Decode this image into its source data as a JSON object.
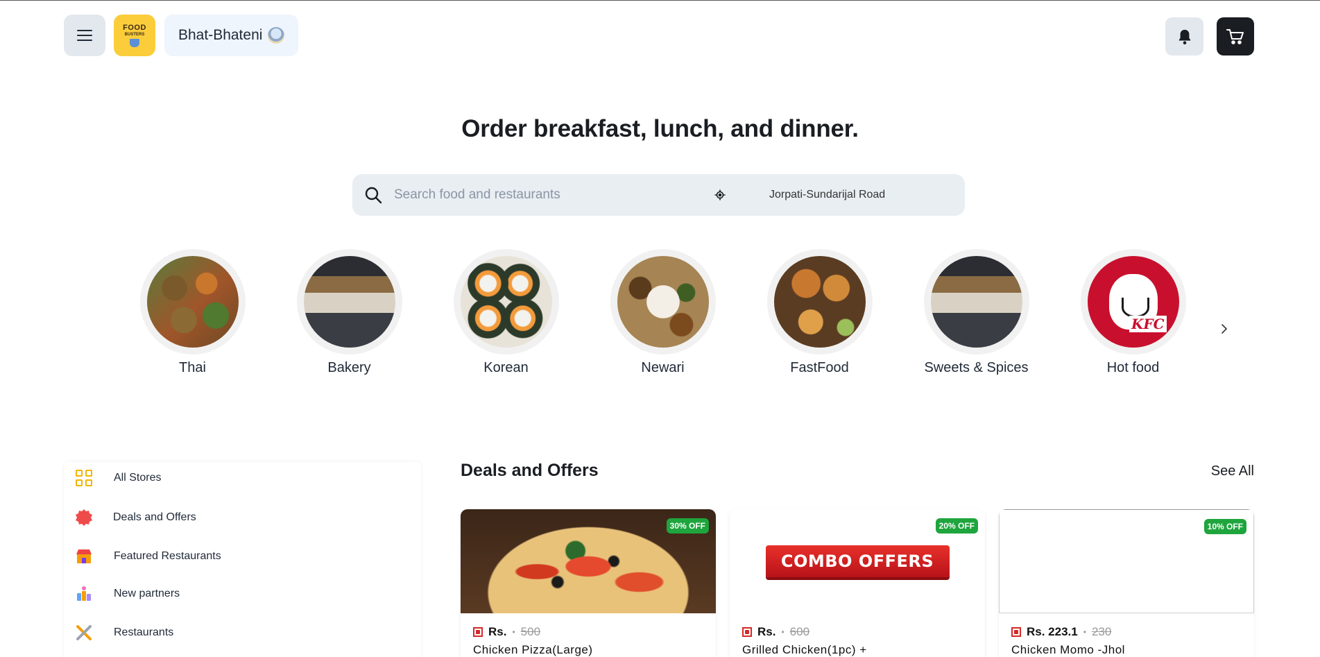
{
  "header": {
    "store_name": "Bhat-Bhateni",
    "logo_line1": "FOOD",
    "logo_line2": "BUSTERS"
  },
  "hero": {
    "title": "Order breakfast, lunch, and dinner.",
    "search_placeholder": "Search food and restaurants",
    "location": "Jorpati-Sundarijal Road"
  },
  "categories": [
    {
      "label": "Thai",
      "icon": "thai-food-image"
    },
    {
      "label": "Bakery",
      "icon": "bakery-image"
    },
    {
      "label": "Korean",
      "icon": "korean-food-image"
    },
    {
      "label": "Newari",
      "icon": "newari-food-image"
    },
    {
      "label": "FastFood",
      "icon": "fastfood-image"
    },
    {
      "label": "Sweets & Spices",
      "icon": "sweets-spices-image"
    },
    {
      "label": "Hot food",
      "icon": "hot-food-image"
    }
  ],
  "kfc_logo_text": "KFC",
  "sidebar": {
    "items": [
      {
        "label": "All Stores",
        "icon": "grid-icon"
      },
      {
        "label": "Deals and Offers",
        "icon": "deal-badge-icon"
      },
      {
        "label": "Featured Restaurants",
        "icon": "featured-store-icon"
      },
      {
        "label": "New partners",
        "icon": "partners-icon"
      },
      {
        "label": "Restaurants",
        "icon": "cutlery-icon"
      }
    ]
  },
  "deals": {
    "title": "Deals and Offers",
    "see_all": "See All",
    "cards": [
      {
        "name": "Chicken Pizza(Large)",
        "price": "Rs.",
        "old_price": "500",
        "discount": "30% OFF"
      },
      {
        "name": "Grilled Chicken(1pc) +",
        "price": "Rs.",
        "old_price": "600",
        "discount": "20% OFF",
        "banner": "COMBO OFFERS"
      },
      {
        "name": "Chicken Momo -Jhol",
        "price": "Rs. 223.1",
        "old_price": "230",
        "discount": "10% OFF"
      }
    ]
  },
  "colors": {
    "accent_yellow": "#fbcd3b",
    "badge_green": "#1fa53d",
    "dark": "#1a1d22",
    "search_bg": "#e9eef3"
  }
}
